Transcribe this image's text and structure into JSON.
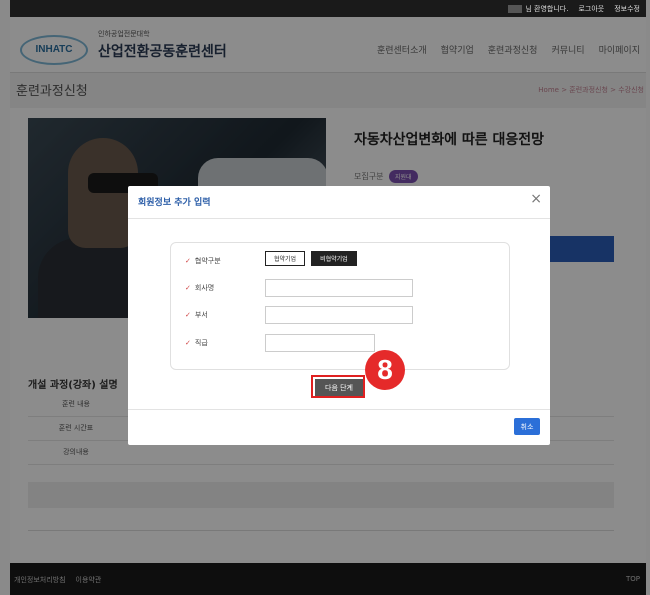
{
  "topbar": {
    "welcome": "님 환영합니다.",
    "logout": "로그아웃",
    "myinfo": "정보수정"
  },
  "logo": {
    "badge_text": "INHATC",
    "small": "인하공업전문대학",
    "title": "산업전환공동훈련센터"
  },
  "nav": {
    "items": [
      "훈련센터소개",
      "협약기업",
      "훈련과정신청",
      "커뮤니티",
      "마이페이지"
    ]
  },
  "page": {
    "title": "훈련과정신청",
    "breadcrumb": "Home > 훈련과정신청 > 수강신청"
  },
  "course": {
    "title": "자동차산업변화에 따른 대응전망",
    "recruit_label": "모집구분",
    "recruit_badge": "지원대"
  },
  "description": {
    "section_title": "개설 과정(강좌) 설명",
    "rows": [
      "훈련 내용",
      "훈련 시간표",
      "강의내용"
    ]
  },
  "footer": {
    "privacy": "개인정보처리방침",
    "terms": "이용약관",
    "top": "TOP"
  },
  "modal": {
    "title": "회원정보 추가 입력",
    "close": "×",
    "fields": {
      "type_label": "협약구분",
      "type_options": [
        "협약기업",
        "비협약기업"
      ],
      "company_label": "회사명",
      "dept_label": "부서",
      "position_label": "직급"
    },
    "next_button": "다음 단계",
    "cancel_button": "취소"
  },
  "annotation": {
    "step_number": "8",
    "color": "#e52a2a"
  }
}
